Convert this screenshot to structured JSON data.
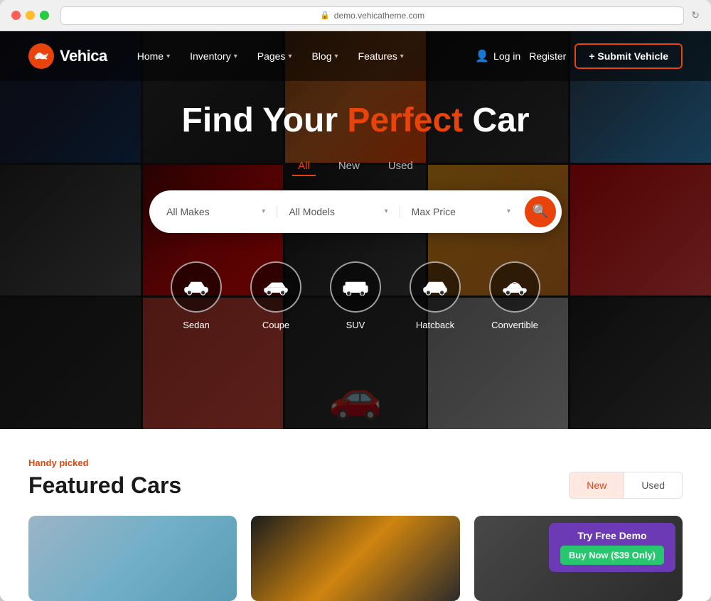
{
  "browser": {
    "url": "demo.vehicatheme.com",
    "refresh_label": "↻"
  },
  "nav": {
    "logo_text": "Vehica",
    "links": [
      {
        "label": "Home",
        "has_dropdown": true
      },
      {
        "label": "Inventory",
        "has_dropdown": true
      },
      {
        "label": "Pages",
        "has_dropdown": true
      },
      {
        "label": "Blog",
        "has_dropdown": true
      },
      {
        "label": "Features",
        "has_dropdown": true
      }
    ],
    "login_label": "Log in",
    "register_label": "Register",
    "submit_label": "+ Submit Vehicle"
  },
  "hero": {
    "title_part1": "Find Your ",
    "title_accent": "Perfect",
    "title_part2": " Car",
    "tabs": [
      {
        "label": "All",
        "active": true
      },
      {
        "label": "New",
        "active": false
      },
      {
        "label": "Used",
        "active": false
      }
    ],
    "search": {
      "makes_placeholder": "All Makes",
      "models_placeholder": "All Models",
      "price_placeholder": "Max Price",
      "search_icon": "🔍"
    },
    "vehicle_types": [
      {
        "label": "Sedan",
        "icon": "sedan"
      },
      {
        "label": "Coupe",
        "icon": "coupe"
      },
      {
        "label": "SUV",
        "icon": "suv"
      },
      {
        "label": "Hatcback",
        "icon": "hatchback"
      },
      {
        "label": "Convertible",
        "icon": "convertible"
      }
    ]
  },
  "featured": {
    "sub_label": "Handy picked",
    "title": "Featured Cars",
    "tabs": [
      {
        "label": "New",
        "active": true
      },
      {
        "label": "Used",
        "active": false
      }
    ]
  },
  "promo": {
    "try_label": "Try Free Demo",
    "buy_label": "Buy Now ($39 Only)"
  },
  "colors": {
    "accent": "#e8430a",
    "promo_bg": "#6c3ab5",
    "promo_btn": "#28c76f"
  }
}
